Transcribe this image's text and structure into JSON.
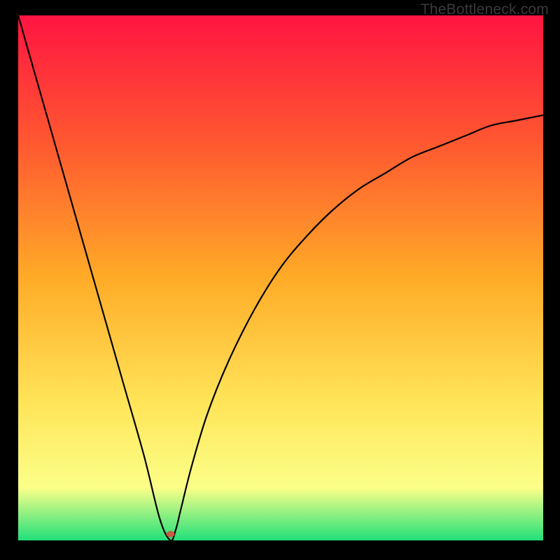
{
  "watermark": "TheBottleneck.com",
  "chart_data": {
    "type": "line",
    "title": "",
    "xlabel": "",
    "ylabel": "",
    "xlim": [
      0,
      100
    ],
    "ylim": [
      0,
      100
    ],
    "gradient_colors": {
      "top": "#ff1442",
      "q1": "#ff5a30",
      "mid": "#ffab27",
      "q3": "#ffe559",
      "q4": "#fbff88",
      "bottom": "#21e07a"
    },
    "curve_note": "Black curve: steep descent from top-left to a minimum near x≈29, y≈0, then asymptotic rise toward upper-right.",
    "series": [
      {
        "name": "bottleneck-curve",
        "x": [
          0,
          4,
          8,
          12,
          16,
          20,
          24,
          27,
          29,
          30,
          31,
          33,
          36,
          40,
          45,
          50,
          55,
          60,
          65,
          70,
          75,
          80,
          85,
          90,
          95,
          100
        ],
        "y": [
          100,
          86,
          72,
          58,
          44,
          30,
          16,
          4,
          0,
          2,
          6,
          14,
          24,
          34,
          44,
          52,
          58,
          63,
          67,
          70,
          73,
          75,
          77,
          79,
          80,
          81
        ]
      }
    ],
    "marker": {
      "x": 29,
      "y": 1.2,
      "color": "#c95b42",
      "rx": 6,
      "ry": 4.5
    }
  }
}
